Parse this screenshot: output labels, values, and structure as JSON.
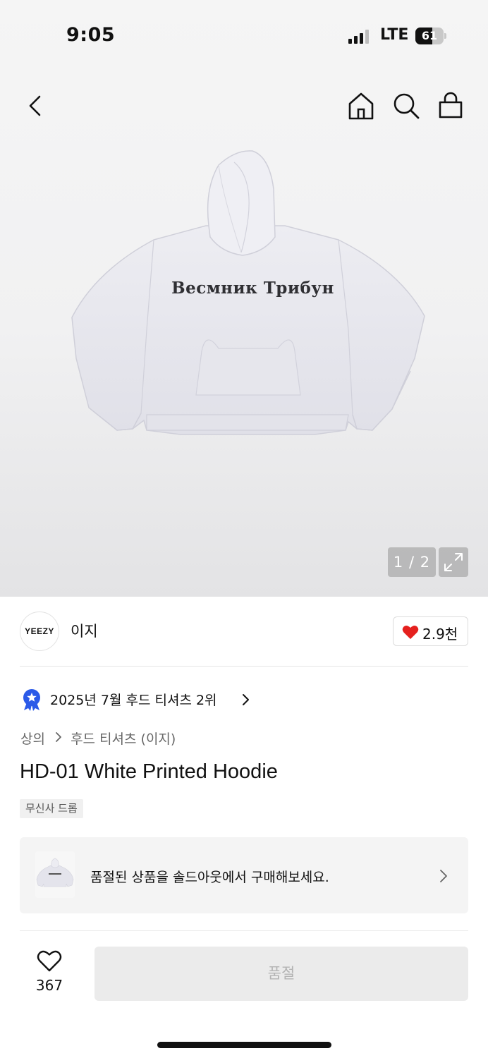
{
  "status_bar": {
    "time": "9:05",
    "network": "LTE",
    "battery": "61",
    "battery_level": 0.61
  },
  "nav": {
    "back_icon": "chevron-left-icon",
    "home_icon": "home-icon",
    "search_icon": "search-icon",
    "cart_icon": "shopping-bag-icon"
  },
  "gallery": {
    "hoodie_print": "Весмник Трибун",
    "indicator": "1 / 2",
    "expand_icon": "expand-icon"
  },
  "brand": {
    "logo": "YEEZY",
    "name": "이지",
    "like_count": "2.9천",
    "like_color": "#e5201e"
  },
  "ranking": {
    "text": "2025년 7월 후드 티셔츠 2위",
    "medal_color": "#2b5ae8"
  },
  "breadcrumb": {
    "items": [
      "상의",
      "후드 티셔츠 (이지)"
    ]
  },
  "product": {
    "title": "HD-01 White Printed Hoodie",
    "tag": "무신사 드롭"
  },
  "resale": {
    "text": "품절된 상품을 솔드아웃에서 구매해보세요."
  },
  "bottom_bar": {
    "wish_count": "367",
    "button_label": "품절"
  }
}
